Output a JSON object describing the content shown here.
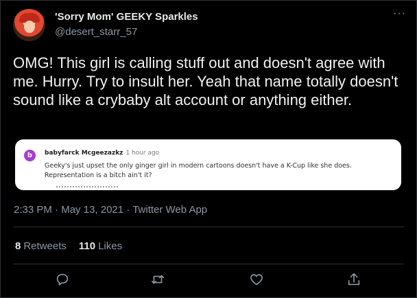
{
  "author": {
    "display_name": "'Sorry Mom' GEEKY Sparkles",
    "handle": "@desert_starr_57"
  },
  "tweet": {
    "text": "OMG! This girl is calling stuff out and doesn't agree with me. Hurry. Try to insult her. Yeah that name totally doesn't sound like a crybaby alt account or anything either."
  },
  "embedded_comment": {
    "avatar_letter": "b",
    "author": "babyfarck Mcgeezazkz",
    "age": "1 hour ago",
    "line1": "Geeky's just upset the only ginger girl in modern cartoons doesn't have a K-Cup like she does.",
    "line2": "Representation is a bitch ain't it?"
  },
  "meta": {
    "time": "2:33 PM",
    "dot": "·",
    "date": "May 13, 2021",
    "source": "Twitter Web App"
  },
  "stats": {
    "retweets_count": "8",
    "retweets_label": "Retweets",
    "likes_count": "110",
    "likes_label": "Likes"
  },
  "icons": {
    "more": "more-dots-icon",
    "reply": "reply-icon",
    "retweet": "retweet-icon",
    "like": "heart-icon",
    "share": "share-icon"
  },
  "colors": {
    "background": "#000000",
    "muted_text": "#8b98a5",
    "comment_avatar": "#a63bd1"
  }
}
